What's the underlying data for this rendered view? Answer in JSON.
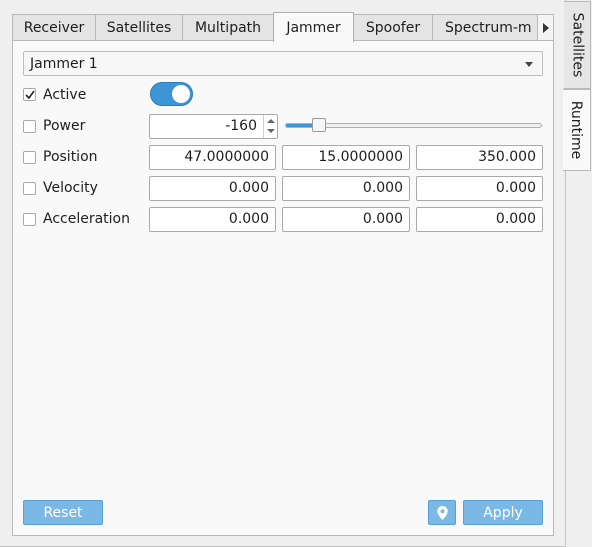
{
  "tabs": [
    {
      "label": "Receiver",
      "active": false
    },
    {
      "label": "Satellites",
      "active": false
    },
    {
      "label": "Multipath",
      "active": false
    },
    {
      "label": "Jammer",
      "active": true
    },
    {
      "label": "Spoofer",
      "active": false
    },
    {
      "label": "Spectrum-m",
      "active": false
    }
  ],
  "side_tabs": [
    {
      "label": "Satellites",
      "active": false
    },
    {
      "label": "Runtime",
      "active": true
    }
  ],
  "jammer_select": {
    "value": "Jammer 1"
  },
  "rows": {
    "active": {
      "label": "Active",
      "checked": true,
      "toggle_on": true
    },
    "power": {
      "label": "Power",
      "checked": false,
      "value": "-160",
      "slider_fraction": 0.11
    },
    "position": {
      "label": "Position",
      "checked": false,
      "values": [
        "47.0000000",
        "15.0000000",
        "350.000"
      ]
    },
    "velocity": {
      "label": "Velocity",
      "checked": false,
      "values": [
        "0.000",
        "0.000",
        "0.000"
      ]
    },
    "acceleration": {
      "label": "Acceleration",
      "checked": false,
      "values": [
        "0.000",
        "0.000",
        "0.000"
      ]
    }
  },
  "buttons": {
    "reset": "Reset",
    "apply": "Apply",
    "location_icon": "map-pin-icon"
  },
  "colors": {
    "accent": "#3d95d6",
    "button": "#7ab8e6"
  }
}
